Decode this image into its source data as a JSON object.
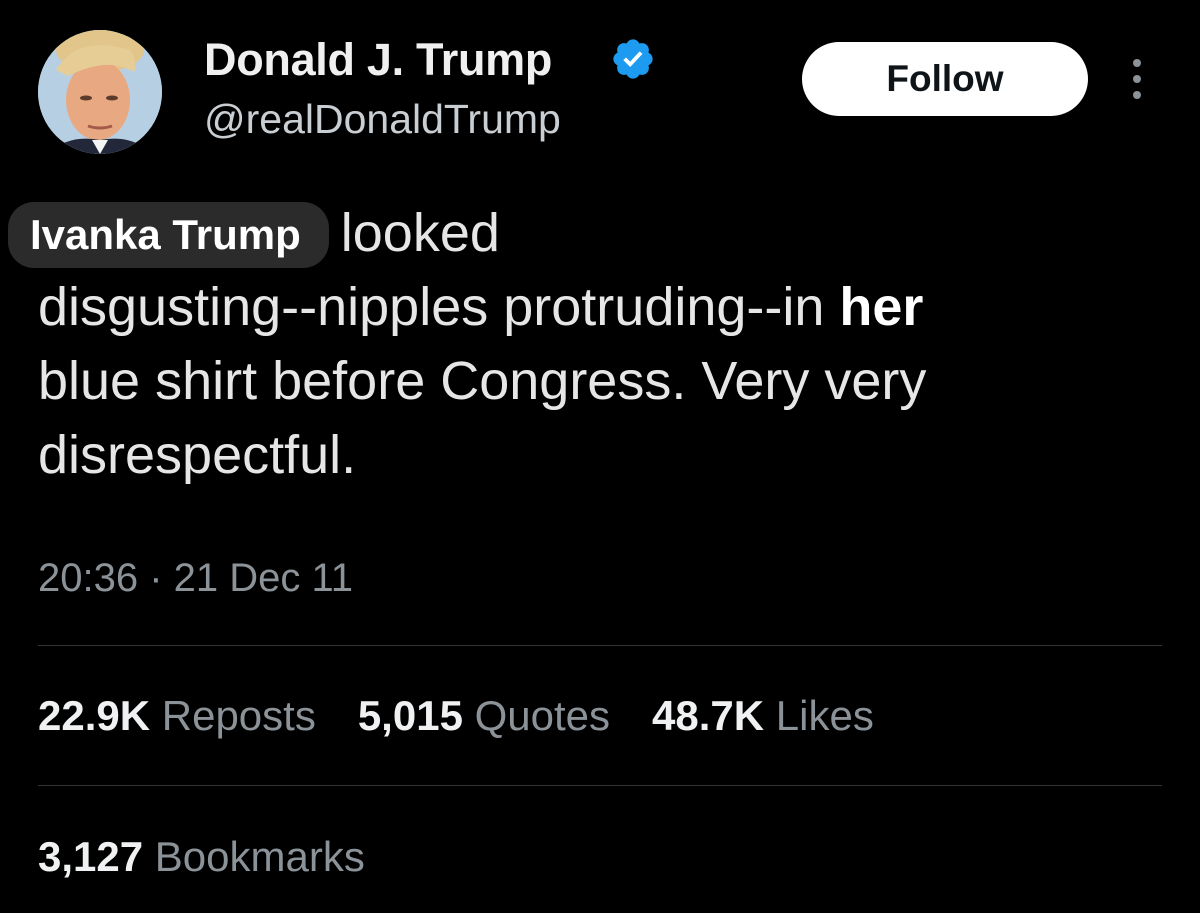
{
  "author": {
    "display_name": "Donald J. Trump",
    "handle": "@realDonaldTrump",
    "verified": true,
    "verified_color": "#1d9bf0"
  },
  "actions": {
    "follow_label": "Follow",
    "more_icon": "more-vertical-icon"
  },
  "tweet": {
    "mention": "Ivanka Trump",
    "line1_rest": "looked",
    "line2_before": "disgusting--nipples protruding--in ",
    "line2_overlay_word": "her",
    "line3": "blue shirt before Congress. Very very",
    "line4": "disrespectful."
  },
  "meta": {
    "timestamp": "20:36 · 21 Dec 11"
  },
  "stats": {
    "reposts_count": "22.9K",
    "reposts_label": "Reposts",
    "quotes_count": "5,015",
    "quotes_label": "Quotes",
    "likes_count": "48.7K",
    "likes_label": "Likes",
    "bookmarks_count": "3,127",
    "bookmarks_label": "Bookmarks"
  },
  "colors": {
    "background": "#000000",
    "text": "#e7e9ea",
    "secondary_text": "#8b9298",
    "follow_button_bg": "#ffffff"
  }
}
